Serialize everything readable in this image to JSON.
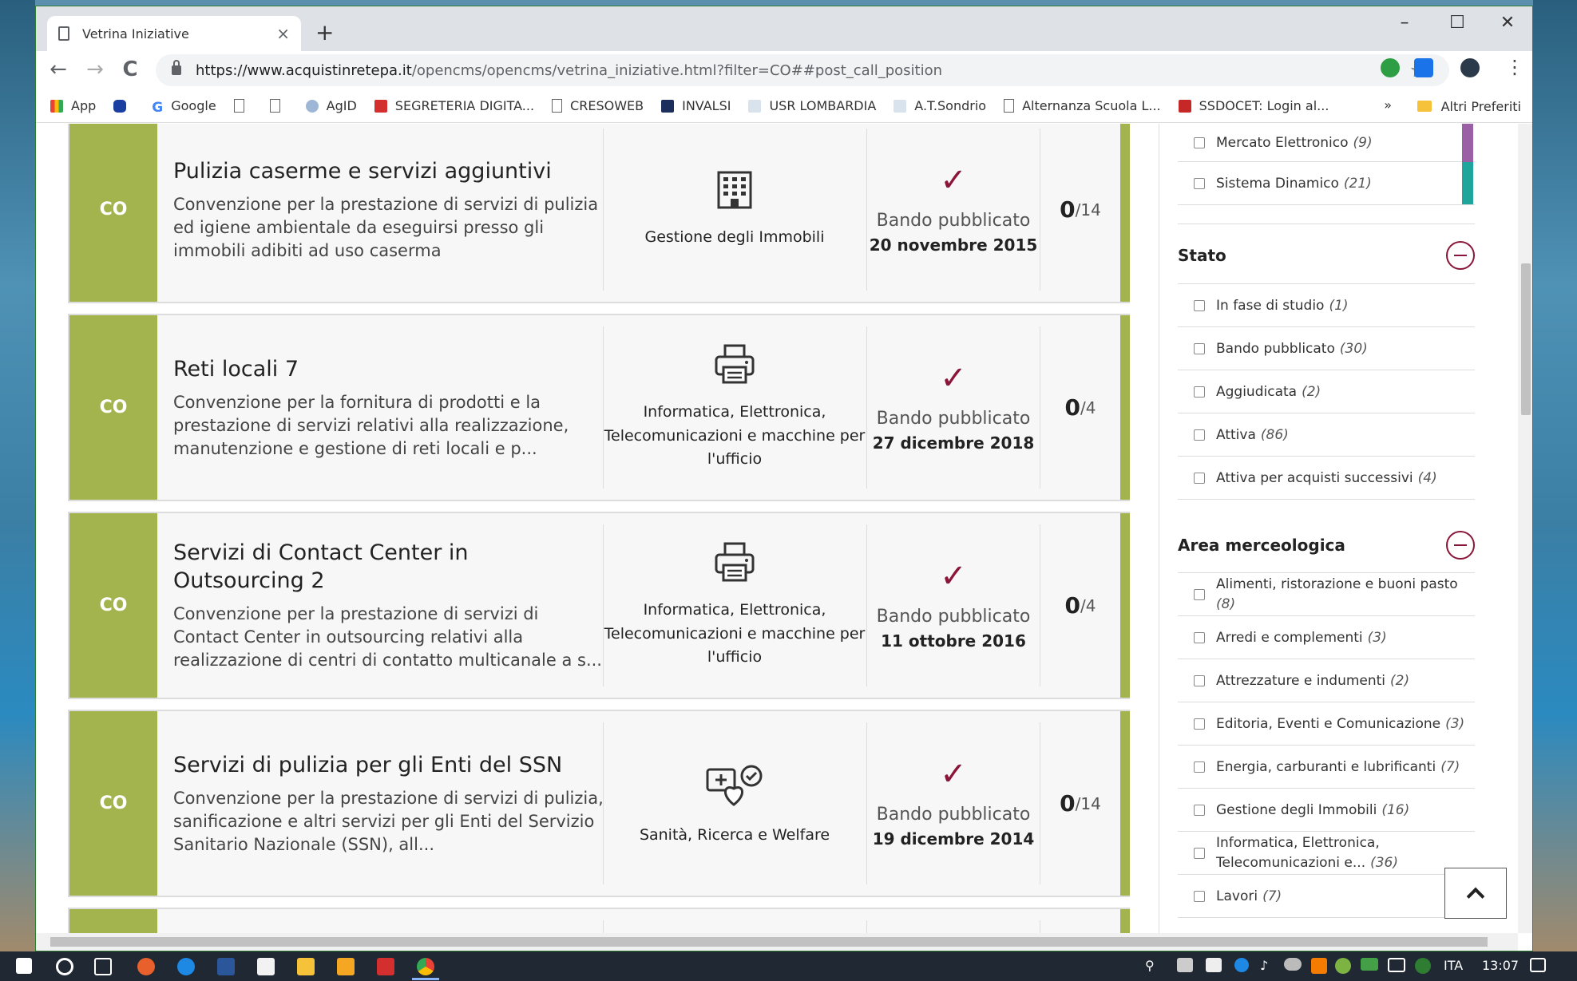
{
  "browser": {
    "tab_title": "Vetrina Iniziative",
    "new_tab": "+",
    "url_host": "https://www.acquistinretepa.it",
    "url_path": "/opencms/opencms/vetrina_iniziative.html?filter=CO##post_call_position",
    "window_controls": {
      "minimize": "–",
      "maximize": "☐",
      "close": "✕"
    },
    "nav": {
      "back": "←",
      "forward": "→",
      "reload": "C"
    },
    "bookmarks": [
      {
        "label": "App"
      },
      {
        "label": ""
      },
      {
        "label": "Google"
      },
      {
        "label": ""
      },
      {
        "label": ""
      },
      {
        "label": "AgID"
      },
      {
        "label": "SEGRETERIA DIGITA..."
      },
      {
        "label": "CRESOWEB"
      },
      {
        "label": "INVALSI"
      },
      {
        "label": "USR LOMBARDIA"
      },
      {
        "label": "A.T.Sondrio"
      },
      {
        "label": "Alternanza Scuola L..."
      },
      {
        "label": "SSDOCET: Login al..."
      }
    ],
    "bookmarks_more": "»",
    "bookmarks_other": "Altri Preferiti"
  },
  "cards": [
    {
      "badge": "CO",
      "title": "Pulizia caserme e servizi aggiuntivi",
      "description": "Convenzione per la prestazione di servizi di pulizia ed igiene ambientale da eseguirsi presso gli immobili adibiti ad uso caserma",
      "category": "Gestione degli Immobili",
      "category_icon": "building-icon",
      "status": "Bando pubblicato",
      "date": "20 novembre 2015",
      "count": "0",
      "count_total": "/14"
    },
    {
      "badge": "CO",
      "title": "Reti locali 7",
      "description": "Convenzione per la fornitura di prodotti e la prestazione di servizi relativi alla realizzazione, manutenzione e gestione di reti locali e p...",
      "category": "Informatica, Elettronica, Telecomunicazioni e macchine per l'ufficio",
      "category_icon": "printer-icon",
      "status": "Bando pubblicato",
      "date": "27 dicembre 2018",
      "count": "0",
      "count_total": "/4"
    },
    {
      "badge": "CO",
      "title": "Servizi di Contact Center in Outsourcing 2",
      "description": "Convenzione per la prestazione di servizi di Contact Center in outsourcing relativi alla realizzazione di centri di contatto multicanale a s...",
      "category": "Informatica, Elettronica, Telecomunicazioni e macchine per l'ufficio",
      "category_icon": "printer-icon",
      "status": "Bando pubblicato",
      "date": "11 ottobre 2016",
      "count": "0",
      "count_total": "/4"
    },
    {
      "badge": "CO",
      "title": "Servizi di pulizia per gli Enti del SSN",
      "description": "Convenzione per la prestazione di servizi di pulizia, sanificazione e altri servizi per gli Enti del Servizio Sanitario Nazionale (SSN), all...",
      "category": "Sanità, Ricerca e Welfare",
      "category_icon": "health-icon",
      "status": "Bando pubblicato",
      "date": "19 dicembre 2014",
      "count": "0",
      "count_total": "/14"
    }
  ],
  "sidebar": {
    "strumento": [
      {
        "label": "Mercato Elettronico",
        "count": "(9)",
        "marker": "#9b5fa5"
      },
      {
        "label": "Sistema Dinamico",
        "count": "(21)",
        "marker": "#1fa59b"
      }
    ],
    "stato_title": "Stato",
    "stato": [
      {
        "label": "In fase di studio",
        "count": "(1)"
      },
      {
        "label": "Bando pubblicato",
        "count": "(30)"
      },
      {
        "label": "Aggiudicata",
        "count": "(2)"
      },
      {
        "label": "Attiva",
        "count": "(86)"
      },
      {
        "label": "Attiva per acquisti successivi",
        "count": "(4)"
      }
    ],
    "area_title": "Area merceologica",
    "area": [
      {
        "label": "Alimenti, ristorazione e buoni pasto",
        "count": "(8)"
      },
      {
        "label": "Arredi e complementi",
        "count": "(3)"
      },
      {
        "label": "Attrezzature e indumenti",
        "count": "(2)"
      },
      {
        "label": "Editoria, Eventi e Comunicazione",
        "count": "(3)"
      },
      {
        "label": "Energia, carburanti e lubrificanti",
        "count": "(7)"
      },
      {
        "label": "Gestione degli Immobili",
        "count": "(16)"
      },
      {
        "label": "Informatica, Elettronica, Telecomunicazioni e...",
        "count": "(36)"
      },
      {
        "label": "Lavori",
        "count": "(7)"
      }
    ]
  },
  "taskbar": {
    "language": "ITA",
    "time": "13:07"
  },
  "colors": {
    "accent_green": "#a3b44e",
    "accent_burgundy": "#8a1538"
  }
}
